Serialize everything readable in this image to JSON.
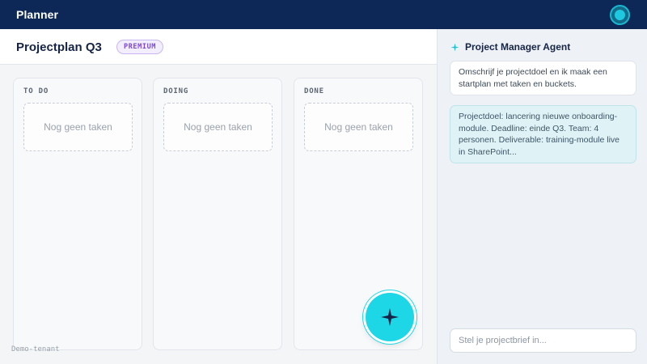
{
  "app": {
    "title": "Planner"
  },
  "board": {
    "title": "Projectplan Q3",
    "badge": "PREMIUM",
    "columns": [
      {
        "title": "TO DO",
        "empty_text": "Nog geen taken"
      },
      {
        "title": "DOING",
        "empty_text": "Nog geen taken"
      },
      {
        "title": "DONE",
        "empty_text": "Nog geen taken"
      }
    ],
    "tenant": "Demo-tenant"
  },
  "agent": {
    "title": "Project Manager Agent",
    "messages": [
      {
        "role": "agent",
        "text": "Omschrijf je projectdoel en ik maak een startplan met taken en buckets."
      },
      {
        "role": "user",
        "text": "Projectdoel: lancering nieuwe onboarding-module. Deadline: einde Q3. Team: 4 personen. Deliverable: training-module live in SharePoint..."
      }
    ],
    "input_placeholder": "Stel je projectbrief in..."
  },
  "colors": {
    "topbar": "#0d2857",
    "accent": "#1dd7e6",
    "badge_purple": "#7b48d4"
  },
  "icons": {
    "avatar": "avatar-icon",
    "sparkle": "sparkle-icon"
  }
}
